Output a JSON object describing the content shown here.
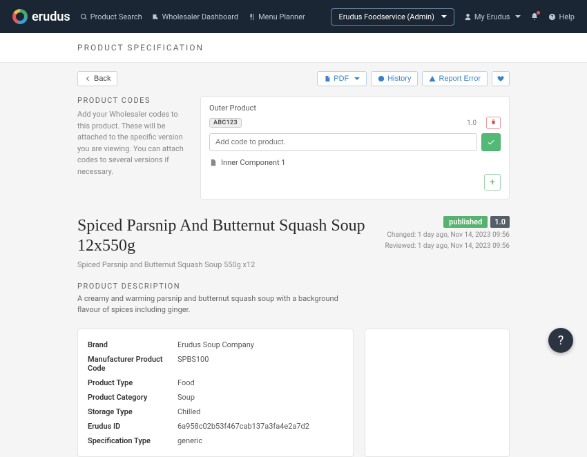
{
  "brand": "erudus",
  "nav": {
    "product_search": "Product Search",
    "wholesaler_dashboard": "Wholesaler Dashboard",
    "menu_planner": "Menu Planner"
  },
  "account_pill": "Erudus Foodservice (Admin)",
  "my_erudus": "My Erudus",
  "help": "Help",
  "page_heading": "PRODUCT SPECIFICATION",
  "back_label": "Back",
  "actions": {
    "pdf": "PDF",
    "history": "History",
    "report_error": "Report Error"
  },
  "codes": {
    "heading": "PRODUCT CODES",
    "blurb": "Add your Wholesaler codes to this product. These will be attached to the specific version you are viewing. You can attach codes to several versions if necessary.",
    "outer_label": "Outer Product",
    "chip": "ABC123",
    "version": "1.0",
    "input_placeholder": "Add code to product.",
    "inner_label": "Inner Component 1"
  },
  "title": "Spiced Parsnip And Butternut Squash Soup 12x550g",
  "subtitle": "Spiced Parsnip and Butternut Squash Soup 550g x12",
  "status": {
    "published": "published",
    "version": "1.0",
    "changed": "Changed: 1 day ago, Nov 14, 2023 09:56",
    "reviewed": "Reviewed: 1 day ago, Nov 14, 2023 09:56"
  },
  "desc": {
    "heading": "PRODUCT DESCRIPTION",
    "text": "A creamy and warming parsnip and butternut squash soup with a background flavour of spices including ginger."
  },
  "details": [
    {
      "k": "Brand",
      "v": "Erudus Soup Company"
    },
    {
      "k": "Manufacturer Product Code",
      "v": "SPBS100"
    },
    {
      "k": "Product Type",
      "v": "Food"
    },
    {
      "k": "Product Category",
      "v": "Soup"
    },
    {
      "k": "Storage Type",
      "v": "Chilled"
    },
    {
      "k": "Erudus ID",
      "v": "6a958c02b53f467cab137a3fa4e2a7d2"
    },
    {
      "k": "Specification Type",
      "v": "generic"
    }
  ]
}
